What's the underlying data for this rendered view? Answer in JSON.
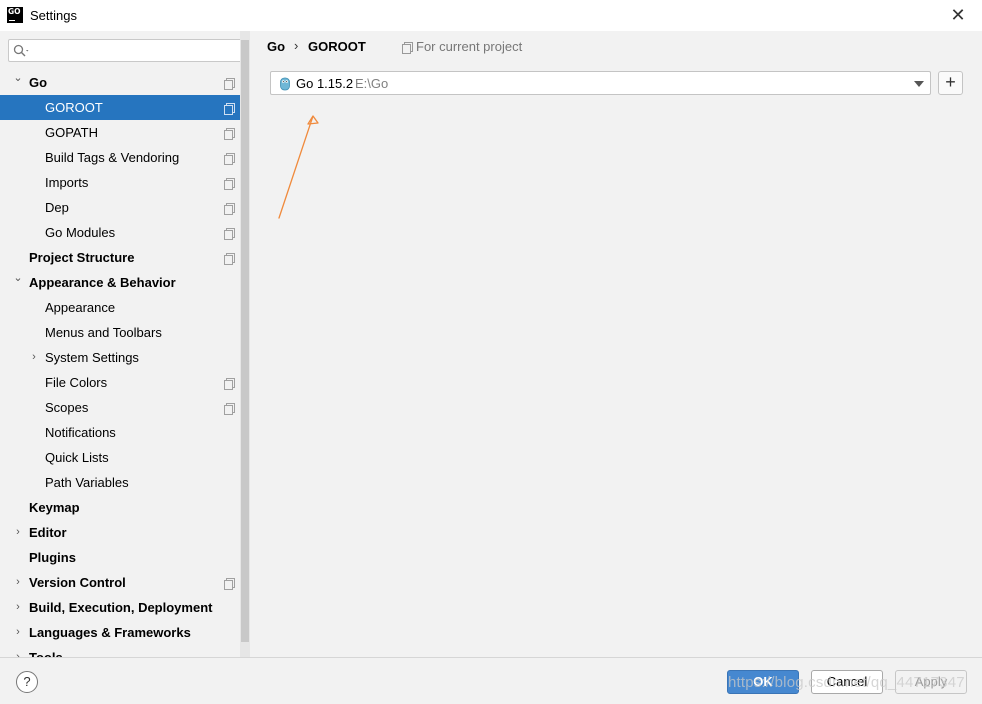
{
  "window": {
    "title": "Settings",
    "app_icon_text": "GO"
  },
  "search": {
    "placeholder": "",
    "value": ""
  },
  "sidebar": {
    "items": [
      {
        "label": "Go",
        "bold": true,
        "chevron": "expanded",
        "project_icon": true
      },
      {
        "label": "GOROOT",
        "selected": true,
        "project_icon": true
      },
      {
        "label": "GOPATH",
        "project_icon": true
      },
      {
        "label": "Build Tags & Vendoring",
        "project_icon": true
      },
      {
        "label": "Imports",
        "project_icon": true
      },
      {
        "label": "Dep",
        "project_icon": true
      },
      {
        "label": "Go Modules",
        "project_icon": true
      },
      {
        "label": "Project Structure",
        "bold": true,
        "project_icon": true
      },
      {
        "label": "Appearance & Behavior",
        "bold": true,
        "chevron": "expanded"
      },
      {
        "label": "Appearance"
      },
      {
        "label": "Menus and Toolbars"
      },
      {
        "label": "System Settings",
        "chevron": "collapsed"
      },
      {
        "label": "File Colors",
        "project_icon": true
      },
      {
        "label": "Scopes",
        "project_icon": true
      },
      {
        "label": "Notifications"
      },
      {
        "label": "Quick Lists"
      },
      {
        "label": "Path Variables"
      },
      {
        "label": "Keymap",
        "bold": true
      },
      {
        "label": "Editor",
        "bold": true,
        "chevron": "collapsed"
      },
      {
        "label": "Plugins",
        "bold": true
      },
      {
        "label": "Version Control",
        "bold": true,
        "chevron": "collapsed",
        "project_icon": true
      },
      {
        "label": "Build, Execution, Deployment",
        "bold": true,
        "chevron": "collapsed"
      },
      {
        "label": "Languages & Frameworks",
        "bold": true,
        "chevron": "collapsed"
      },
      {
        "label": "Tools",
        "bold": true,
        "chevron": "collapsed"
      }
    ]
  },
  "breadcrumb": {
    "parent": "Go",
    "separator": "›",
    "current": "GOROOT",
    "scope_note": "For current project"
  },
  "sdk": {
    "name": "Go 1.15.2",
    "path": "E:\\Go",
    "add_label": "+"
  },
  "annotation": {
    "color": "#f08a3c"
  },
  "footer": {
    "help_label": "?",
    "ok_label": "OK",
    "cancel_label": "Cancel",
    "apply_label": "Apply"
  },
  "watermark": "https://blog.csdn.net/qq_44717347",
  "colors": {
    "selection": "#2675bf",
    "ok_button": "#4688d0"
  }
}
